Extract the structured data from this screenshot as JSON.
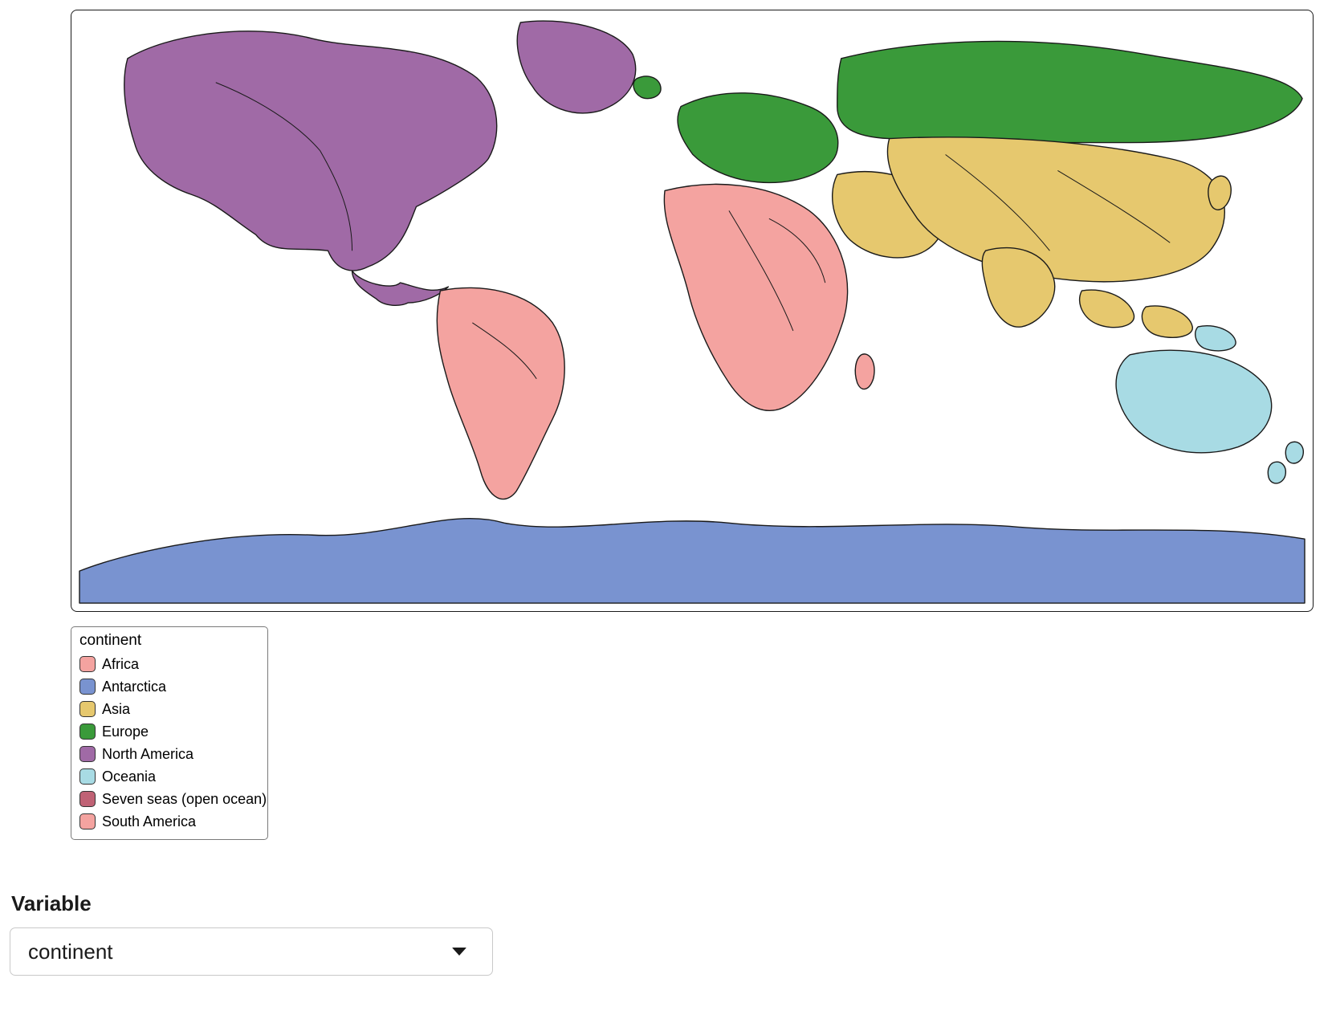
{
  "legend": {
    "title": "continent",
    "items": [
      {
        "label": "Africa",
        "color": "#f4a3a0"
      },
      {
        "label": "Antarctica",
        "color": "#7993d0"
      },
      {
        "label": "Asia",
        "color": "#e6c86e"
      },
      {
        "label": "Europe",
        "color": "#3a9a3a"
      },
      {
        "label": "North America",
        "color": "#a06aa6"
      },
      {
        "label": "Oceania",
        "color": "#a8dbe4"
      },
      {
        "label": "Seven seas (open ocean)",
        "color": "#c06275"
      },
      {
        "label": "South America",
        "color": "#f4a3a0"
      }
    ]
  },
  "control": {
    "label": "Variable",
    "value": "continent"
  },
  "map": {
    "coloring_variable": "continent",
    "stroke": "#1a1a1a",
    "regions": {
      "north_america": {
        "continent": "North America",
        "color": "#a06aa6"
      },
      "south_america": {
        "continent": "South America",
        "color": "#f4a3a0"
      },
      "europe": {
        "continent": "Europe",
        "color": "#3a9a3a"
      },
      "russia": {
        "continent": "Europe",
        "color": "#3a9a3a"
      },
      "africa": {
        "continent": "Africa",
        "color": "#f4a3a0"
      },
      "middle_east": {
        "continent": "Asia",
        "color": "#e6c86e"
      },
      "asia": {
        "continent": "Asia",
        "color": "#e6c86e"
      },
      "se_asia": {
        "continent": "Asia",
        "color": "#e6c86e"
      },
      "oceania": {
        "continent": "Oceania",
        "color": "#a8dbe4"
      },
      "antarctica": {
        "continent": "Antarctica",
        "color": "#7993d0"
      },
      "greenland": {
        "continent": "North America",
        "color": "#a06aa6"
      },
      "iceland": {
        "continent": "Europe",
        "color": "#3a9a3a"
      }
    }
  }
}
